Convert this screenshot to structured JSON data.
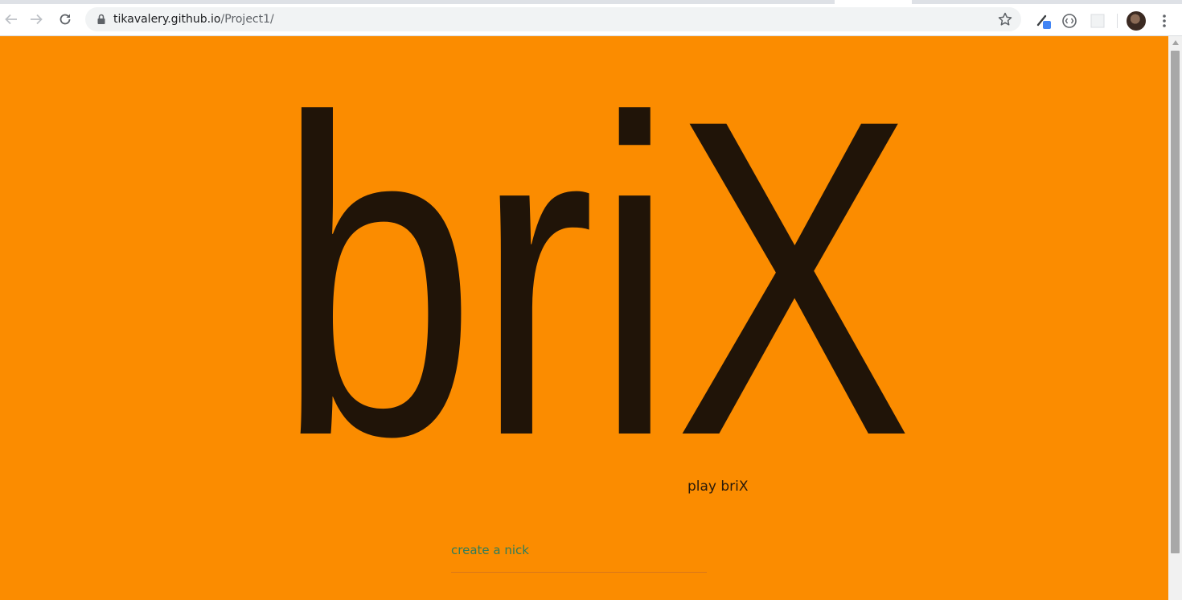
{
  "browser": {
    "url_host": "tikavalery.github.io",
    "url_path": "/Project1/",
    "icons": {
      "back": "arrow-left-icon",
      "forward": "arrow-right-icon",
      "reload": "reload-icon",
      "lock": "lock-icon",
      "star": "star-icon",
      "menu": "kebab-menu-icon"
    }
  },
  "page": {
    "background_color": "#fb8c00",
    "logo_text": "briX",
    "logo_color": "#201408",
    "play_label": "play briX",
    "nick_placeholder": "create a nick",
    "nick_value": ""
  }
}
